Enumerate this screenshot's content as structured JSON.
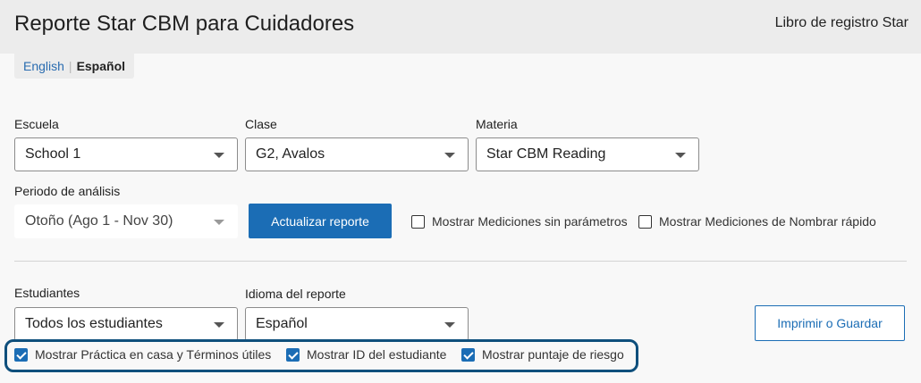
{
  "header": {
    "title": "Reporte Star CBM para Cuidadores",
    "link": "Libro de registro Star"
  },
  "language_switch": {
    "english": "English",
    "separator": "|",
    "spanish": "Español"
  },
  "filters": {
    "school": {
      "label": "Escuela",
      "value": "School 1"
    },
    "class": {
      "label": "Clase",
      "value": "G2, Avalos"
    },
    "subject": {
      "label": "Materia",
      "value": "Star CBM Reading"
    },
    "period": {
      "label": "Periodo de análisis",
      "value": "Otoño (Ago 1 - Nov 30)"
    },
    "update_button": "Actualizar reporte",
    "show_no_params": {
      "label": "Mostrar Mediciones sin parámetros",
      "checked": false
    },
    "show_quick_name": {
      "label": "Mostrar Mediciones de Nombrar rápido",
      "checked": false
    }
  },
  "options": {
    "students": {
      "label": "Estudiantes",
      "value": "Todos los estudiantes"
    },
    "report_language": {
      "label": "Idioma del reporte",
      "value": "Español"
    },
    "print_button": "Imprimir o Guardar",
    "show_home_practice": {
      "label": "Mostrar Práctica en casa y Términos útiles",
      "checked": true
    },
    "show_student_id": {
      "label": "Mostrar ID del estudiante",
      "checked": true
    },
    "show_risk_score": {
      "label": "Mostrar puntaje de riesgo",
      "checked": true
    }
  },
  "colors": {
    "accent": "#1b6db5",
    "highlight_border": "#0e4f7c",
    "header_bg": "#ececec"
  }
}
